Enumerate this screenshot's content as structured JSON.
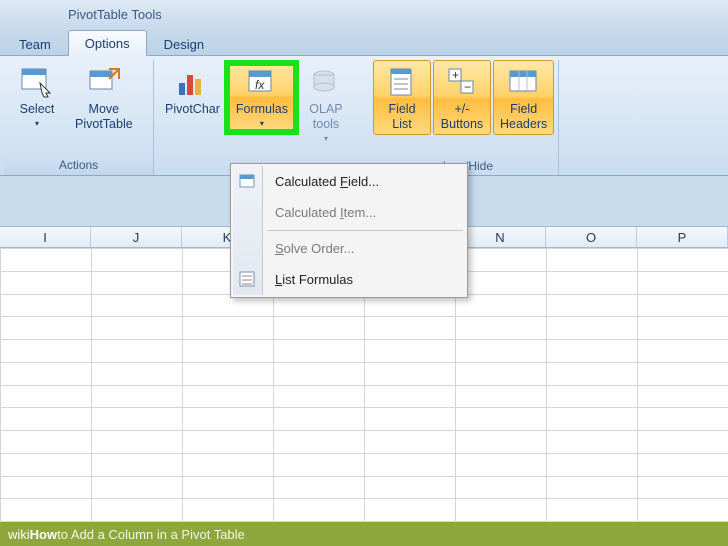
{
  "title": "PivotTable Tools",
  "tabs": {
    "team": "Team",
    "options": "Options",
    "design": "Design"
  },
  "ribbon": {
    "actions_label": "Actions",
    "show_hide_label": "how/Hide",
    "select": "Select",
    "move": "Move\nPivotTable",
    "pivotchart": "PivotChar",
    "formulas": "Formulas",
    "olap": "OLAP\ntools",
    "field_list": "Field\nList",
    "pm_buttons": "+/-\nButtons",
    "field_headers": "Field\nHeaders"
  },
  "menu": {
    "calc_field": "Calculated Field...",
    "calc_item": "Calculated Item...",
    "solve_order": "Solve Order...",
    "list_formulas": "List Formulas"
  },
  "columns": [
    "I",
    "J",
    "K",
    "",
    "",
    "N",
    "O",
    "P"
  ],
  "footer": {
    "wiki": "wiki",
    "how": "How",
    "rest": " to Add a Column in a Pivot Table"
  }
}
